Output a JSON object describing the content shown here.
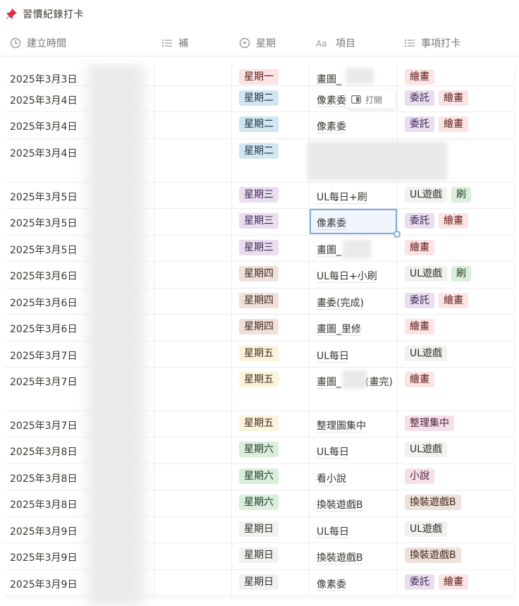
{
  "page": {
    "title": "習慣紀錄打卡"
  },
  "columns": {
    "created": "建立時間",
    "note": "補",
    "weekday": "星期",
    "item": "項目",
    "checkin": "事項打卡"
  },
  "popover": {
    "open_label": "打開"
  },
  "colors": {
    "red": {
      "bg": "#fbe4e4",
      "fg": "#5d1715"
    },
    "blue": {
      "bg": "#d3e5ef",
      "fg": "#183347"
    },
    "purple": {
      "bg": "#e8deee",
      "fg": "#412454"
    },
    "brown": {
      "bg": "#eee0da",
      "fg": "#442a1e"
    },
    "yellow": {
      "bg": "#fbf3db",
      "fg": "#402c1b"
    },
    "green": {
      "bg": "#dbeddb",
      "fg": "#1c3829"
    },
    "gray": {
      "bg": "#f1f1ef",
      "fg": "#32302c"
    },
    "pink": {
      "bg": "#f5e0e9",
      "fg": "#4c2337"
    }
  },
  "rows": [
    {
      "date": "2025年3月3日",
      "weekday": "星期一",
      "weekday_color": "red",
      "item": "畫圖_",
      "tags": [
        {
          "label": "繪畫",
          "color": "red"
        }
      ]
    },
    {
      "date": "2025年3月4日",
      "weekday": "星期二",
      "weekday_color": "blue",
      "item": "像素委",
      "tags": [
        {
          "label": "委託",
          "color": "purple"
        },
        {
          "label": "繪畫",
          "color": "red"
        }
      ]
    },
    {
      "date": "2025年3月4日",
      "weekday": "星期二",
      "weekday_color": "blue",
      "item": "像素委",
      "tags": [
        {
          "label": "委託",
          "color": "purple"
        },
        {
          "label": "繪畫",
          "color": "red"
        }
      ]
    },
    {
      "date": "2025年3月4日",
      "weekday": "星期二",
      "weekday_color": "blue",
      "item": "",
      "tags": []
    },
    {
      "date": "2025年3月5日",
      "weekday": "星期三",
      "weekday_color": "purple",
      "item": "UL每日+刷",
      "tags": [
        {
          "label": "UL遊戲",
          "color": "gray"
        },
        {
          "label": "刷",
          "color": "green"
        }
      ]
    },
    {
      "date": "2025年3月5日",
      "weekday": "星期三",
      "weekday_color": "purple",
      "item": "像素委",
      "tags": [
        {
          "label": "委託",
          "color": "purple"
        },
        {
          "label": "繪畫",
          "color": "red"
        }
      ]
    },
    {
      "date": "2025年3月5日",
      "weekday": "星期三",
      "weekday_color": "purple",
      "item": "畫圖_",
      "tags": [
        {
          "label": "繪畫",
          "color": "red"
        }
      ]
    },
    {
      "date": "2025年3月6日",
      "weekday": "星期四",
      "weekday_color": "brown",
      "item": "UL每日+小刷",
      "tags": [
        {
          "label": "UL遊戲",
          "color": "gray"
        },
        {
          "label": "刷",
          "color": "green"
        }
      ]
    },
    {
      "date": "2025年3月6日",
      "weekday": "星期四",
      "weekday_color": "brown",
      "item": "畫委(完成)",
      "tags": [
        {
          "label": "委託",
          "color": "purple"
        },
        {
          "label": "繪畫",
          "color": "red"
        }
      ]
    },
    {
      "date": "2025年3月6日",
      "weekday": "星期四",
      "weekday_color": "brown",
      "item": "畫圖_里修",
      "tags": [
        {
          "label": "繪畫",
          "color": "red"
        }
      ]
    },
    {
      "date": "2025年3月7日",
      "weekday": "星期五",
      "weekday_color": "yellow",
      "item": "UL每日",
      "tags": [
        {
          "label": "UL遊戲",
          "color": "gray"
        }
      ]
    },
    {
      "date": "2025年3月7日",
      "weekday": "星期五",
      "weekday_color": "yellow",
      "item": "畫圖_",
      "item_tail": "(畫完)",
      "tags": [
        {
          "label": "繪畫",
          "color": "red"
        }
      ]
    },
    {
      "date": "2025年3月7日",
      "weekday": "星期五",
      "weekday_color": "yellow",
      "item": "整理圖集中",
      "tags": [
        {
          "label": "整理集中",
          "color": "pink"
        }
      ]
    },
    {
      "date": "2025年3月8日",
      "weekday": "星期六",
      "weekday_color": "green",
      "item": "UL每日",
      "tags": [
        {
          "label": "UL遊戲",
          "color": "gray"
        }
      ]
    },
    {
      "date": "2025年3月8日",
      "weekday": "星期六",
      "weekday_color": "green",
      "item": "看小說",
      "tags": [
        {
          "label": "小說",
          "color": "pink"
        }
      ]
    },
    {
      "date": "2025年3月8日",
      "weekday": "星期六",
      "weekday_color": "green",
      "item": "換裝遊戲B",
      "tags": [
        {
          "label": "換裝遊戲B",
          "color": "brown"
        }
      ]
    },
    {
      "date": "2025年3月9日",
      "weekday": "星期日",
      "weekday_color": "gray",
      "item": "UL每日",
      "tags": [
        {
          "label": "UL遊戲",
          "color": "gray"
        }
      ]
    },
    {
      "date": "2025年3月9日",
      "weekday": "星期日",
      "weekday_color": "gray",
      "item": "換裝遊戲B",
      "tags": [
        {
          "label": "換裝遊戲B",
          "color": "brown"
        }
      ]
    },
    {
      "date": "2025年3月9日",
      "weekday": "星期日",
      "weekday_color": "gray",
      "item": "像素委",
      "tags": [
        {
          "label": "委託",
          "color": "purple"
        },
        {
          "label": "繪畫",
          "color": "red"
        }
      ]
    }
  ]
}
